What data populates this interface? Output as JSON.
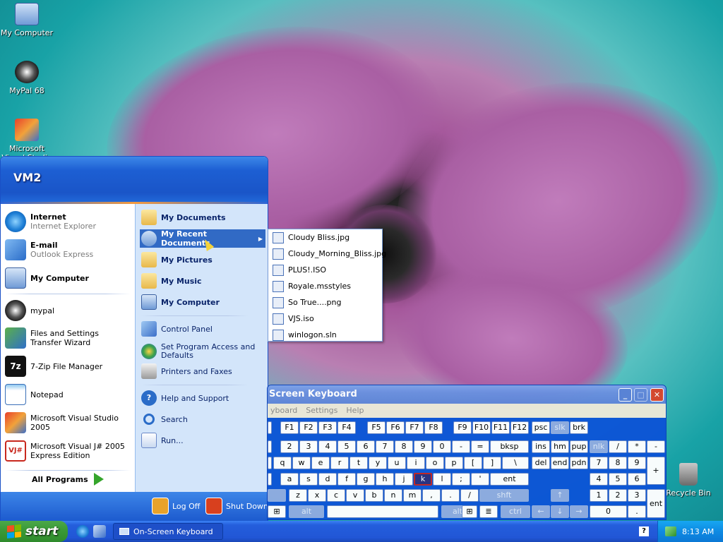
{
  "desktop": {
    "icons": [
      {
        "label": "My Computer"
      },
      {
        "label": "MyPal 68"
      },
      {
        "label": "Microsoft Visual Studio 2005"
      },
      {
        "label": "Recycle Bin"
      }
    ]
  },
  "start_menu": {
    "user": "VM2",
    "pinned": [
      {
        "title": "Internet",
        "sub": "Internet Explorer"
      },
      {
        "title": "E-mail",
        "sub": "Outlook Express"
      },
      {
        "title": "My Computer",
        "sub": ""
      }
    ],
    "recent_programs": [
      "mypal",
      "Files and Settings Transfer Wizard",
      "7-Zip File Manager",
      "Notepad",
      "Microsoft Visual Studio 2005",
      "Microsoft Visual J# 2005 Express Edition"
    ],
    "all_programs": "All Programs",
    "right_items": [
      "My Documents",
      "My Recent Documents",
      "My Pictures",
      "My Music",
      "My Computer",
      "Control Panel",
      "Set Program Access and Defaults",
      "Printers and Faxes",
      "Help and Support",
      "Search",
      "Run..."
    ],
    "log_off": "Log Off",
    "shut_down": "Shut Down"
  },
  "recent_docs": [
    "Cloudy Bliss.jpg",
    "Cloudy_Morning_Bliss.jpg",
    "PLUS!.ISO",
    "Royale.msstyles",
    "So True....png",
    "VJS.iso",
    "winlogon.sln"
  ],
  "osk": {
    "title": "Screen Keyboard",
    "menu": [
      "yboard",
      "Settings",
      "Help"
    ],
    "selected_key": "k"
  },
  "taskbar": {
    "start": "start",
    "task": "On-Screen Keyboard",
    "clock": "8:13 AM"
  },
  "colors": {
    "taskbar": "#245edc",
    "start": "#3b9b38",
    "highlight": "#316ac5"
  }
}
